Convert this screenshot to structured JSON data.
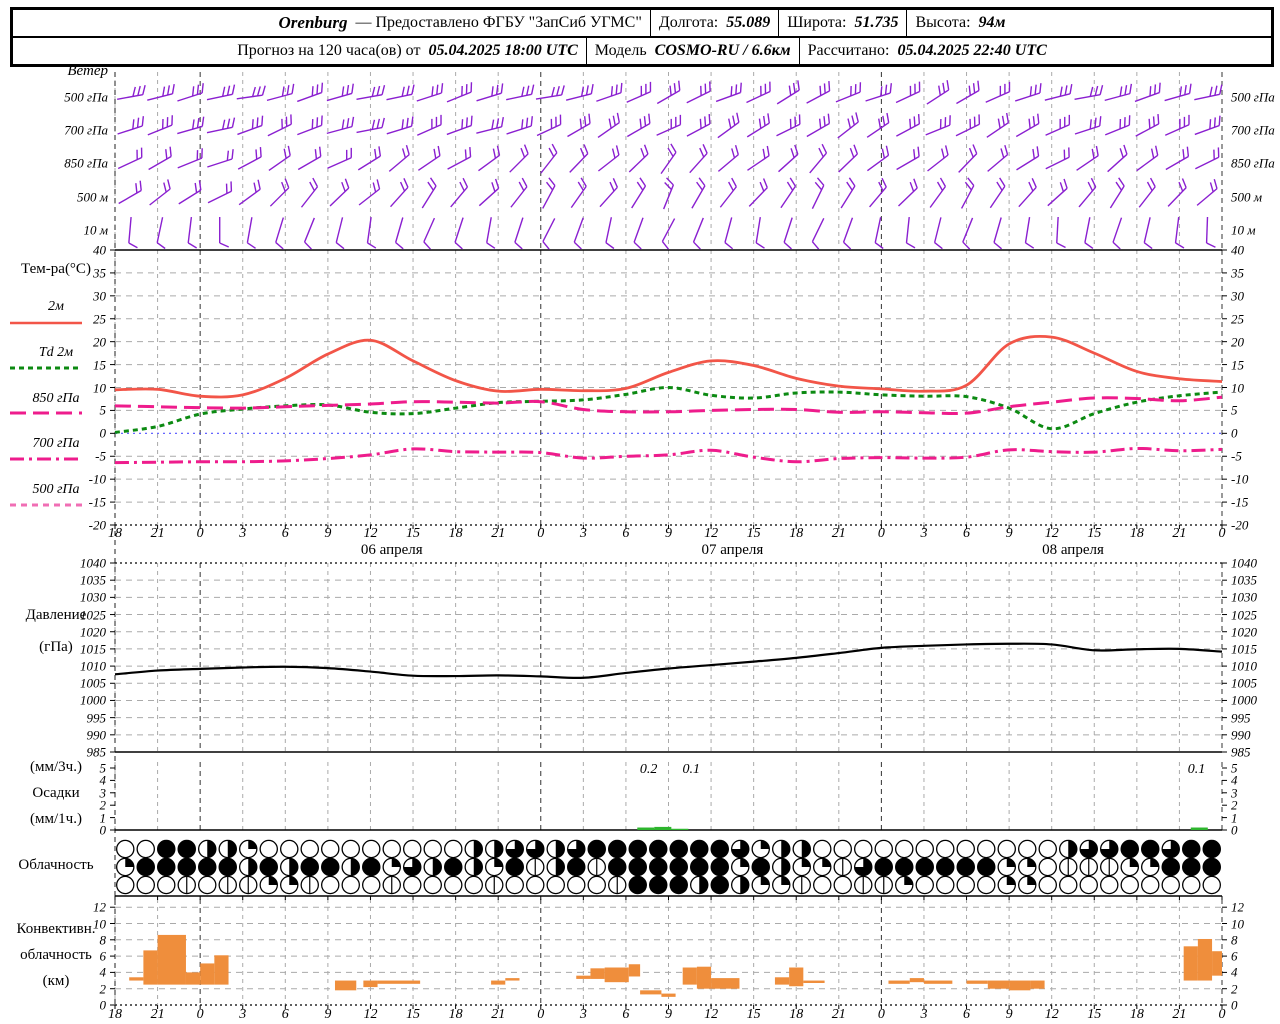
{
  "colors": {
    "wind_barb": "#8a1fd0",
    "temp_2m": "#f25548",
    "dewpoint": "#0c8a12",
    "t850": "#ee1c8c",
    "t700": "#ee1c8c",
    "t500": "#f06eb4",
    "zero_line": "#5050ff",
    "pressure_line": "#000000",
    "precip_bar": "#2db52d",
    "convective_bar": "#ef8e3c",
    "grid_minor": "#aaaaaa",
    "grid_day": "#333333"
  },
  "header": {
    "station": "Orenburg",
    "provider": "— Предоставлено ФГБУ \"ЗапСиб УГМС\"",
    "lon_label": "Долгота:",
    "lon": "55.089",
    "lat_label": "Широта:",
    "lat": "51.735",
    "alt_label": "Высота:",
    "alt": "94м",
    "forecast_label": "Прогноз на 120 часа(ов) от",
    "run_time": "05.04.2025 18:00 UTC",
    "model_label": "Модель",
    "model": "COSMO-RU / 6.6км",
    "calc_label": "Рассчитано:",
    "calc_time": "05.04.2025 22:40 UTC"
  },
  "axis": {
    "hour_labels": [
      "18",
      "21",
      "0",
      "3",
      "6",
      "9",
      "12",
      "15",
      "18",
      "21",
      "0",
      "3",
      "6",
      "9",
      "12",
      "15",
      "18",
      "21",
      "0",
      "3",
      "6",
      "9",
      "12",
      "15",
      "18",
      "21",
      "0"
    ],
    "date_labels": [
      "06 апреля",
      "07 апреля",
      "08 апреля"
    ],
    "date_hour_positions": [
      19.5,
      43.5,
      67.5
    ]
  },
  "chart_data": [
    {
      "id": "wind",
      "type": "wind-barbs",
      "title": "Ветер",
      "levels": [
        {
          "label": "500 гПа",
          "feathers": 3,
          "angles": [
            -10,
            -14,
            -18,
            -12,
            -8,
            -15,
            -20,
            -16,
            -10,
            -12,
            -18,
            -22,
            -17,
            -12,
            -9,
            -14,
            -19,
            -24,
            -30,
            -26,
            -20,
            -25,
            -32,
            -28,
            -22,
            -18,
            -25,
            -33,
            -30,
            -24,
            -18,
            -14,
            -10,
            -15,
            -20,
            -16,
            -12
          ]
        },
        {
          "label": "700 гПа",
          "feathers": 3,
          "angles": [
            -18,
            -22,
            -16,
            -12,
            -20,
            -26,
            -21,
            -15,
            -11,
            -17,
            -24,
            -20,
            -14,
            -18,
            -25,
            -30,
            -35,
            -30,
            -24,
            -28,
            -36,
            -32,
            -26,
            -30,
            -38,
            -34,
            -28,
            -22,
            -26,
            -34,
            -30,
            -24,
            -18,
            -22,
            -28,
            -24,
            -20
          ]
        },
        {
          "label": "850 гПа",
          "feathers": 2,
          "angles": [
            -25,
            -30,
            -22,
            -18,
            -28,
            -35,
            -30,
            -24,
            -32,
            -40,
            -34,
            -28,
            -36,
            -45,
            -52,
            -46,
            -38,
            -44,
            -55,
            -48,
            -40,
            -34,
            -42,
            -50,
            -44,
            -36,
            -30,
            -38,
            -46,
            -40,
            -32,
            -26,
            -34,
            -42,
            -36,
            -30,
            -26
          ]
        },
        {
          "label": "500 м",
          "feathers": 2,
          "angles": [
            -30,
            -38,
            -32,
            -26,
            -36,
            -45,
            -52,
            -44,
            -38,
            -48,
            -58,
            -50,
            -42,
            -52,
            -62,
            -55,
            -48,
            -58,
            -68,
            -60,
            -52,
            -46,
            -56,
            -64,
            -58,
            -50,
            -44,
            -54,
            -62,
            -56,
            -48,
            -42,
            -50,
            -58,
            -52,
            -46,
            -40
          ]
        },
        {
          "label": "10 м",
          "feathers": 1,
          "angles": [
            95,
            102,
            97,
            90,
            100,
            107,
            112,
            104,
            98,
            106,
            114,
            108,
            100,
            108,
            117,
            110,
            102,
            110,
            118,
            112,
            105,
            99,
            108,
            116,
            110,
            102,
            96,
            104,
            112,
            106,
            99,
            93,
            101,
            109,
            103,
            97,
            92
          ]
        }
      ]
    },
    {
      "id": "temperature",
      "type": "line",
      "title": "Тем-ра(°C)",
      "ylim": [
        -20,
        40
      ],
      "yticks": [
        40,
        35,
        30,
        25,
        20,
        15,
        10,
        5,
        0,
        -5,
        -10,
        -15,
        -20
      ],
      "x_step_hours": 3,
      "series": [
        {
          "name": "2м",
          "style": "solid",
          "color_key": "temp_2m",
          "values": [
            9.5,
            9.6,
            8.1,
            8.4,
            12.0,
            17.3,
            20.3,
            15.8,
            11.5,
            9.2,
            9.6,
            9.3,
            9.8,
            13.3,
            15.8,
            14.8,
            12.0,
            10.3,
            9.7,
            9.2,
            10.5,
            19.5,
            21.0,
            17.5,
            13.5,
            11.9,
            11.3
          ]
        },
        {
          "name": "Td 2м",
          "style": "dash",
          "color_key": "dewpoint",
          "values": [
            0.2,
            1.5,
            4.2,
            5.3,
            6.0,
            6.2,
            4.6,
            4.3,
            5.5,
            6.7,
            7.0,
            7.3,
            8.5,
            10.0,
            8.3,
            7.7,
            8.8,
            9.0,
            8.4,
            8.1,
            8.0,
            5.5,
            1.0,
            4.3,
            6.8,
            8.2,
            9.0
          ]
        },
        {
          "name": "850 гПа",
          "style": "longdash",
          "color_key": "t850",
          "values": [
            6.0,
            5.8,
            5.6,
            5.5,
            5.8,
            6.1,
            6.4,
            6.9,
            6.8,
            6.6,
            6.9,
            5.2,
            4.7,
            4.7,
            5.0,
            5.2,
            5.2,
            4.6,
            4.7,
            4.5,
            4.4,
            5.8,
            6.8,
            7.7,
            7.6,
            7.1,
            7.9
          ]
        },
        {
          "name": "700 гПа",
          "style": "dashdot",
          "color_key": "t700",
          "values": [
            -6.4,
            -6.3,
            -6.2,
            -6.2,
            -6.0,
            -5.5,
            -4.7,
            -3.4,
            -4.0,
            -4.1,
            -4.2,
            -5.4,
            -5.0,
            -4.7,
            -3.7,
            -5.2,
            -6.2,
            -5.5,
            -5.3,
            -5.4,
            -5.2,
            -3.6,
            -4.0,
            -4.1,
            -3.3,
            -3.8,
            -3.5
          ]
        },
        {
          "name": "500 гПа",
          "style": "shortdash",
          "color_key": "t500",
          "values": []
        }
      ]
    },
    {
      "id": "pressure",
      "type": "line",
      "label1": "Давление",
      "label2": "(гПа)",
      "ylim": [
        985,
        1040
      ],
      "yticks": [
        1040,
        1035,
        1030,
        1025,
        1020,
        1015,
        1010,
        1005,
        1000,
        995,
        990,
        985
      ],
      "values": [
        1007.6,
        1008.7,
        1009.2,
        1009.6,
        1009.8,
        1009.4,
        1008.4,
        1007.2,
        1007.1,
        1007.3,
        1007.0,
        1006.6,
        1008.0,
        1009.3,
        1010.3,
        1011.3,
        1012.4,
        1013.8,
        1015.3,
        1015.9,
        1016.3,
        1016.5,
        1016.3,
        1014.6,
        1014.9,
        1015.0,
        1014.2
      ]
    },
    {
      "id": "precipitation",
      "type": "bar",
      "label1": "(мм/3ч.)",
      "label2": "Осадки",
      "label3": "(мм/1ч.)",
      "ylim": [
        0,
        5.5
      ],
      "yticks": [
        5,
        4,
        3,
        2,
        1,
        0
      ],
      "bars": [
        {
          "t": 36.8,
          "w": 1.2,
          "v": 0.2
        },
        {
          "t": 38.0,
          "w": 1.2,
          "v": 0.25
        },
        {
          "t": 39.2,
          "w": 1.2,
          "v": 0.1
        },
        {
          "t": 75.8,
          "w": 1.2,
          "v": 0.2
        }
      ],
      "annotations": [
        {
          "t": 37.6,
          "text": "0.2"
        },
        {
          "t": 40.6,
          "text": "0.1"
        },
        {
          "t": 76.2,
          "text": "0.1"
        }
      ]
    },
    {
      "id": "cloudiness",
      "type": "symbols",
      "label": "Облачность",
      "octa_rows": [
        [
          0,
          0,
          8,
          8,
          4,
          4,
          2,
          0,
          0,
          0,
          0,
          0,
          0,
          0,
          0,
          0,
          0,
          4,
          4,
          6,
          6,
          4,
          6,
          8,
          8,
          8,
          8,
          8,
          8,
          8,
          6,
          2,
          4,
          4,
          0,
          0,
          0,
          0,
          0,
          0,
          0,
          0,
          0,
          0,
          0,
          0,
          4,
          6,
          6,
          8,
          8,
          6,
          8,
          8
        ],
        [
          2,
          8,
          8,
          8,
          8,
          8,
          4,
          8,
          4,
          8,
          8,
          4,
          8,
          2,
          6,
          4,
          8,
          4,
          2,
          8,
          1,
          4,
          8,
          1,
          8,
          8,
          8,
          8,
          8,
          8,
          2,
          8,
          4,
          2,
          2,
          1,
          6,
          8,
          8,
          8,
          8,
          8,
          8,
          2,
          2,
          0,
          1,
          1,
          1,
          2,
          2,
          8,
          8,
          8
        ],
        [
          0,
          0,
          0,
          1,
          0,
          1,
          1,
          2,
          2,
          1,
          0,
          0,
          0,
          1,
          0,
          0,
          0,
          0,
          1,
          0,
          0,
          0,
          0,
          0,
          1,
          8,
          8,
          8,
          4,
          8,
          4,
          2,
          2,
          1,
          0,
          0,
          1,
          1,
          2,
          0,
          0,
          0,
          0,
          2,
          2,
          0,
          0,
          0,
          0,
          0,
          0,
          0,
          0,
          0
        ]
      ]
    },
    {
      "id": "convective",
      "type": "range-bar",
      "label1": "Конвективн.",
      "label2": "облачность",
      "label3": "(км)",
      "ylim": [
        0,
        13
      ],
      "yticks": [
        12,
        10,
        8,
        6,
        4,
        2,
        0
      ],
      "bars": [
        [
          1,
          2,
          3.0,
          3.4
        ],
        [
          2,
          3,
          2.5,
          6.7
        ],
        [
          3,
          5,
          2.5,
          8.6
        ],
        [
          5,
          6,
          2.5,
          4.0
        ],
        [
          6,
          7,
          2.5,
          5.1
        ],
        [
          7,
          8,
          2.5,
          6.1
        ],
        [
          15.5,
          17,
          1.8,
          3.0
        ],
        [
          17.5,
          18.5,
          2.2,
          3.0
        ],
        [
          18.5,
          21.5,
          2.6,
          3.0
        ],
        [
          26.5,
          27.5,
          2.5,
          3.0
        ],
        [
          27.5,
          28.5,
          3.0,
          3.3
        ],
        [
          32.5,
          33.5,
          3.2,
          3.6
        ],
        [
          33.5,
          34.5,
          3.2,
          4.5
        ],
        [
          34.5,
          36.2,
          2.8,
          4.6
        ],
        [
          36.2,
          37,
          3.5,
          5.0
        ],
        [
          37,
          38.5,
          1.3,
          1.8
        ],
        [
          38.5,
          39.5,
          1.0,
          1.4
        ],
        [
          40,
          41,
          2.5,
          4.6
        ],
        [
          41,
          42,
          2.0,
          4.7
        ],
        [
          42,
          44,
          2.0,
          3.3
        ],
        [
          46.5,
          47.5,
          2.5,
          3.4
        ],
        [
          47.5,
          48.5,
          2.3,
          4.6
        ],
        [
          48.5,
          50,
          2.7,
          3.0
        ],
        [
          54.5,
          56,
          2.6,
          3.0
        ],
        [
          56,
          57,
          2.8,
          3.3
        ],
        [
          57,
          59,
          2.6,
          3.0
        ],
        [
          60,
          61.5,
          2.6,
          3.0
        ],
        [
          61.5,
          63,
          2.0,
          3.0
        ],
        [
          63,
          64.5,
          1.8,
          3.0
        ],
        [
          64.5,
          65.5,
          2.0,
          3.0
        ],
        [
          75.3,
          76.3,
          3.0,
          7.2
        ],
        [
          76.3,
          77.3,
          3.0,
          8.1
        ],
        [
          77.3,
          78,
          3.6,
          6.6
        ]
      ]
    }
  ]
}
